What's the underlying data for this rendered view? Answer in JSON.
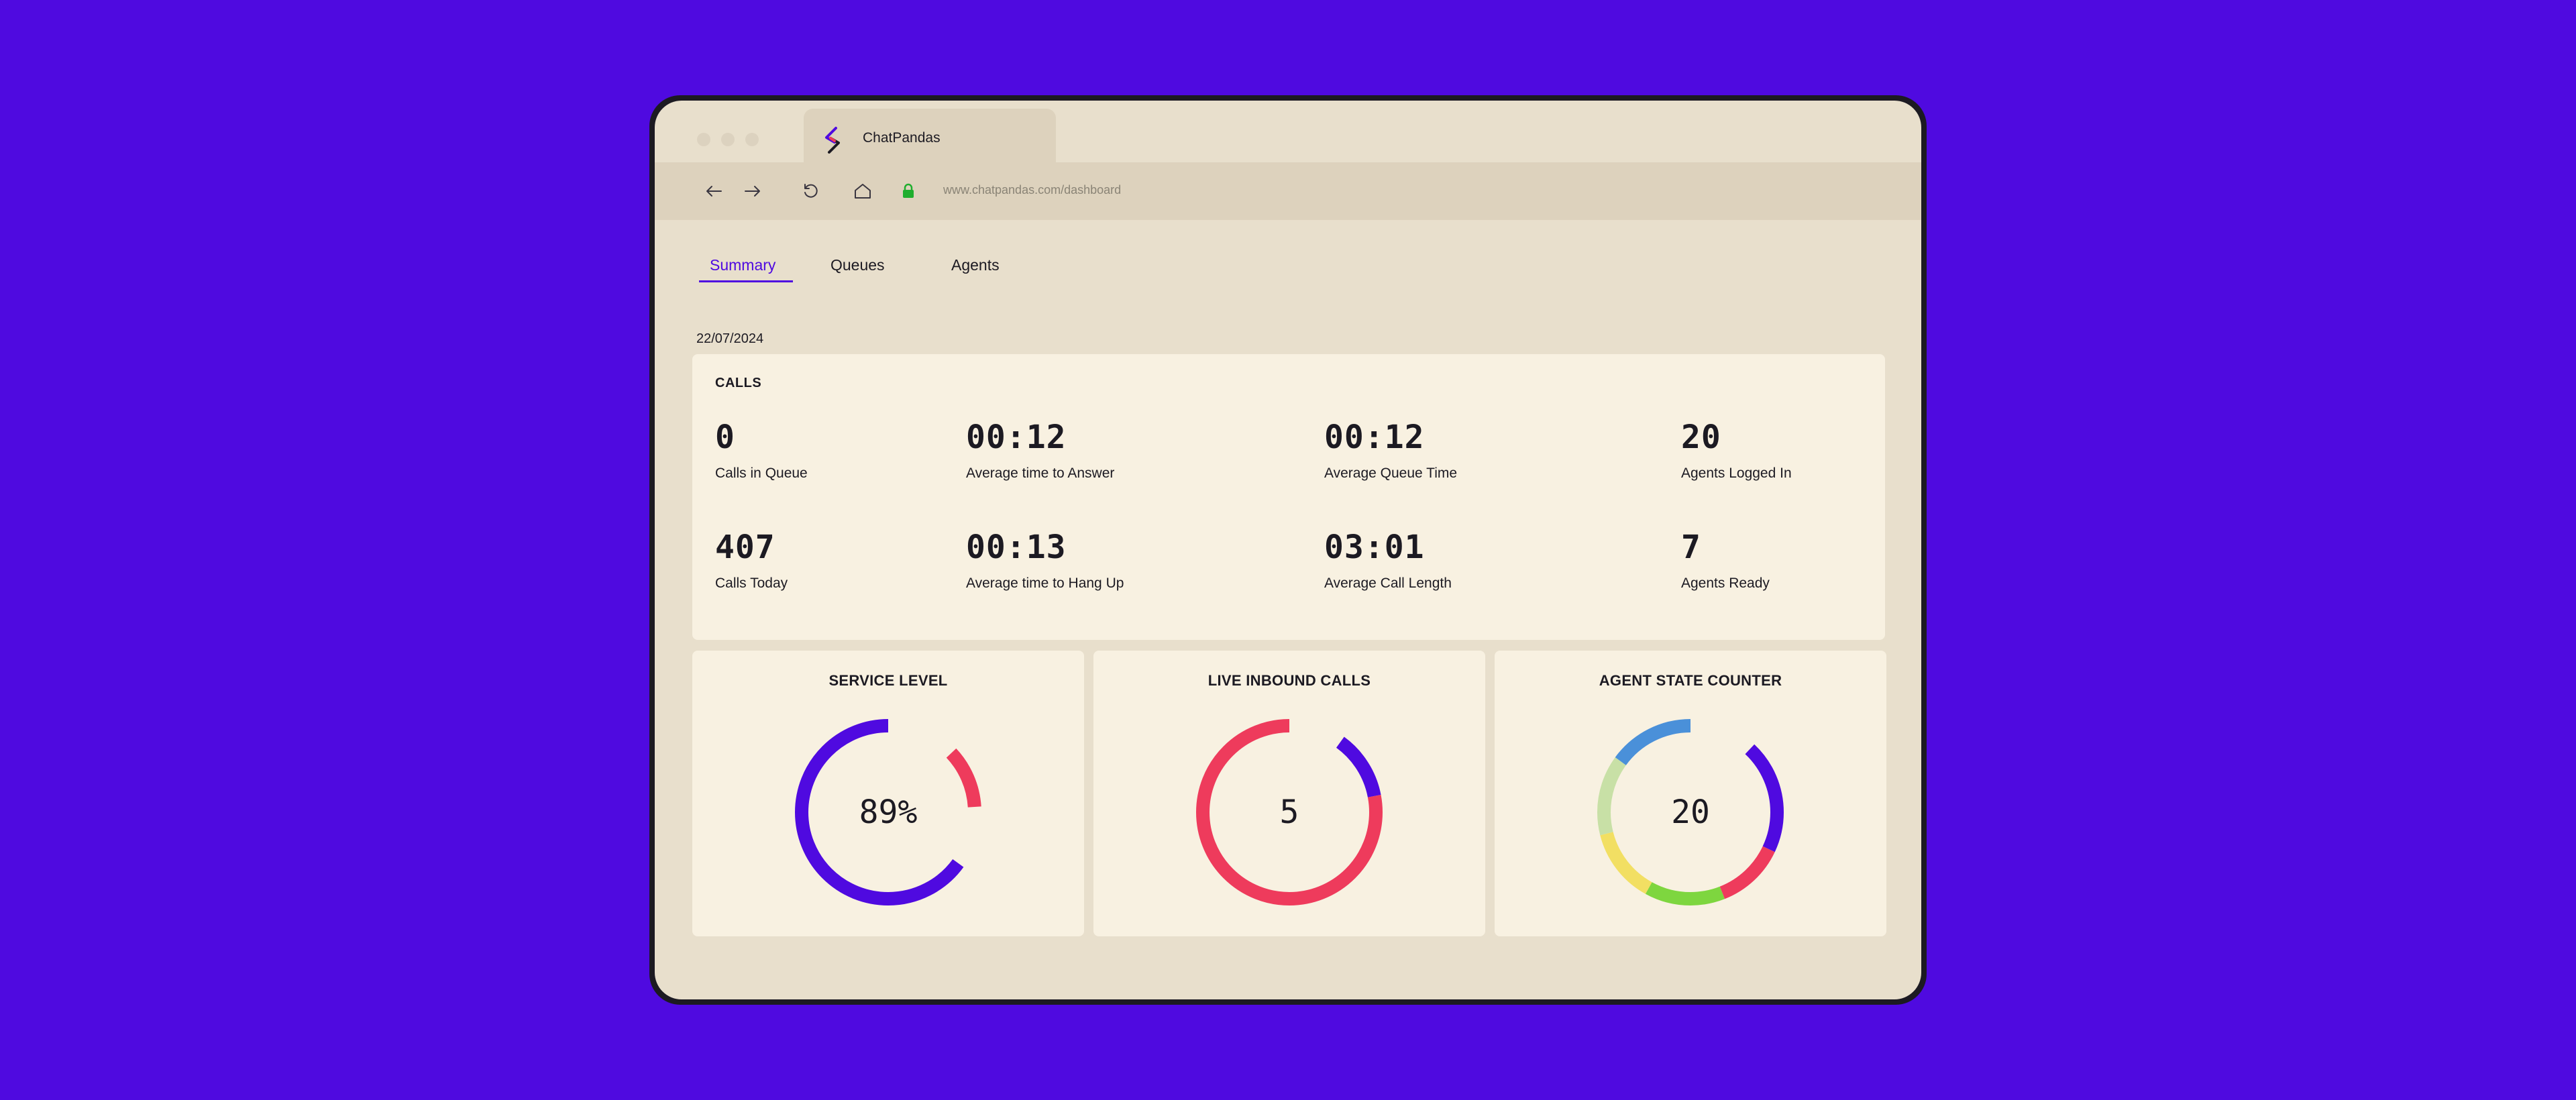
{
  "browser": {
    "tab_title": "ChatPandas",
    "url": "www.chatpandas.com/dashboard",
    "icons": {
      "back": "arrow-left-icon",
      "forward": "arrow-right-icon",
      "reload": "reload-icon",
      "home": "home-icon",
      "lock": "lock-icon"
    }
  },
  "nav": {
    "tabs": [
      {
        "label": "Summary",
        "active": true
      },
      {
        "label": "Queues",
        "active": false
      },
      {
        "label": "Agents",
        "active": false
      }
    ]
  },
  "date": "22/07/2024",
  "calls": {
    "heading": "CALLS",
    "stats": [
      {
        "value": "0",
        "label": "Calls in Queue"
      },
      {
        "value": "00:12",
        "label": "Average time to Answer"
      },
      {
        "value": "00:12",
        "label": "Average Queue Time"
      },
      {
        "value": "20",
        "label": "Agents Logged In"
      },
      {
        "value": "407",
        "label": "Calls Today"
      },
      {
        "value": "00:13",
        "label": "Average time to Hang Up"
      },
      {
        "value": "03:01",
        "label": "Average Call Length"
      },
      {
        "value": "7",
        "label": "Agents Ready"
      }
    ]
  },
  "gauges": [
    {
      "title": "SERVICE LEVEL",
      "center": "89%",
      "segments": [
        {
          "fraction": 0.89,
          "color": "#4f0ae0"
        },
        {
          "fraction": 0.11,
          "color": "#ee3b5c"
        }
      ],
      "start_fraction": 0.35
    },
    {
      "title": "LIVE INBOUND CALLS",
      "center": "5",
      "segments": [
        {
          "fraction": 0.12,
          "color": "#4f0ae0"
        },
        {
          "fraction": 0.88,
          "color": "#ee3b5c"
        }
      ],
      "start_fraction": 0.1
    },
    {
      "title": "AGENT STATE COUNTER",
      "center": "20",
      "segments": [
        {
          "fraction": 0.2,
          "color": "#4f0ae0"
        },
        {
          "fraction": 0.12,
          "color": "#ee3b5c"
        },
        {
          "fraction": 0.14,
          "color": "#7ed63f"
        },
        {
          "fraction": 0.13,
          "color": "#f2df63"
        },
        {
          "fraction": 0.14,
          "color": "#c8e0a6"
        },
        {
          "fraction": 0.27,
          "color": "#4a90d9"
        }
      ],
      "start_fraction": 0.12
    }
  ],
  "colors": {
    "accent": "#4f0ae0",
    "background": "#4f0ae0",
    "page": "#e8dfcc",
    "card": "#f8f1e1"
  }
}
